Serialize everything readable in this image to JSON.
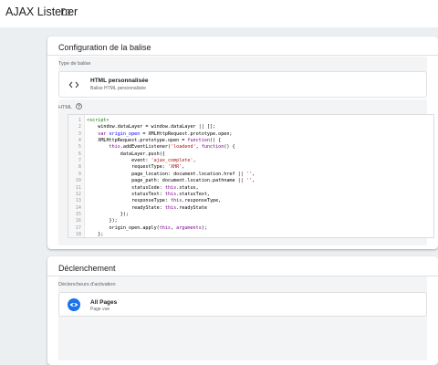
{
  "header": {
    "title": "AJAX Listener",
    "folder_icon": "folder-icon"
  },
  "config": {
    "title": "Configuration de la balise",
    "tag_type_label": "Type de balise",
    "tag_type_name": "HTML personnalisée",
    "tag_type_sub": "Balise HTML personnalisée",
    "tag_type_icon": "code-icon",
    "html_label": "HTML",
    "html_help_icon": "help-icon",
    "code_lines": [
      {
        "n": "1",
        "t": [
          [
            "tag",
            "<script>"
          ]
        ]
      },
      {
        "n": "2",
        "t": [
          [
            "plain",
            "    window.dataLayer = window.dataLayer || [];"
          ]
        ]
      },
      {
        "n": "3",
        "t": [
          [
            "kw",
            "    var "
          ],
          [
            "def",
            "origin_open"
          ],
          [
            "plain",
            " = XMLHttpRequest.prototype.open;"
          ]
        ]
      },
      {
        "n": "4",
        "t": [
          [
            "plain",
            "    XMLHttpRequest.prototype.open = "
          ],
          [
            "kw",
            "function"
          ],
          [
            "plain",
            "() {"
          ]
        ]
      },
      {
        "n": "5",
        "t": [
          [
            "plain",
            "        "
          ],
          [
            "kw",
            "this"
          ],
          [
            "plain",
            ".addEventListener("
          ],
          [
            "str",
            "'loadend'"
          ],
          [
            "plain",
            ", "
          ],
          [
            "kw",
            "function"
          ],
          [
            "plain",
            "() {"
          ]
        ]
      },
      {
        "n": "6",
        "t": [
          [
            "plain",
            "            dataLayer.push({"
          ]
        ]
      },
      {
        "n": "7",
        "t": [
          [
            "plain",
            "                event: "
          ],
          [
            "str",
            "'ajax_complete'"
          ],
          [
            "plain",
            ","
          ]
        ]
      },
      {
        "n": "8",
        "t": [
          [
            "plain",
            "                requestType: "
          ],
          [
            "str",
            "'XHR'"
          ],
          [
            "plain",
            ","
          ]
        ]
      },
      {
        "n": "9",
        "t": [
          [
            "plain",
            "                page_location: document.location.href || "
          ],
          [
            "str",
            "''"
          ],
          [
            "plain",
            ","
          ]
        ]
      },
      {
        "n": "10",
        "t": [
          [
            "plain",
            "                page_path: document.location.pathname || "
          ],
          [
            "str",
            "''"
          ],
          [
            "plain",
            ","
          ]
        ]
      },
      {
        "n": "11",
        "t": [
          [
            "plain",
            "                statusCode: "
          ],
          [
            "kw",
            "this"
          ],
          [
            "plain",
            ".status,"
          ]
        ]
      },
      {
        "n": "12",
        "t": [
          [
            "plain",
            "                statusText: "
          ],
          [
            "kw",
            "this"
          ],
          [
            "plain",
            ".statusText,"
          ]
        ]
      },
      {
        "n": "13",
        "t": [
          [
            "plain",
            "                responseType: "
          ],
          [
            "kw",
            "this"
          ],
          [
            "plain",
            ".responseType,"
          ]
        ]
      },
      {
        "n": "14",
        "t": [
          [
            "plain",
            "                readyState: "
          ],
          [
            "kw",
            "this"
          ],
          [
            "plain",
            ".readyState"
          ]
        ]
      },
      {
        "n": "15",
        "t": [
          [
            "plain",
            "            });"
          ]
        ]
      },
      {
        "n": "16",
        "t": [
          [
            "plain",
            "        });"
          ]
        ]
      },
      {
        "n": "17",
        "t": [
          [
            "plain",
            "        origin_open.apply("
          ],
          [
            "kw",
            "this"
          ],
          [
            "plain",
            ", "
          ],
          [
            "kw",
            "arguments"
          ],
          [
            "plain",
            ");"
          ]
        ]
      },
      {
        "n": "18",
        "t": [
          [
            "plain",
            "    };"
          ]
        ]
      }
    ]
  },
  "triggering": {
    "title": "Déclenchement",
    "triggers_label": "Déclencheurs d'activation",
    "trigger_name": "All Pages",
    "trigger_sub": "Page vue",
    "trigger_icon": "eye-icon",
    "trigger_color": "#1a73e8"
  }
}
